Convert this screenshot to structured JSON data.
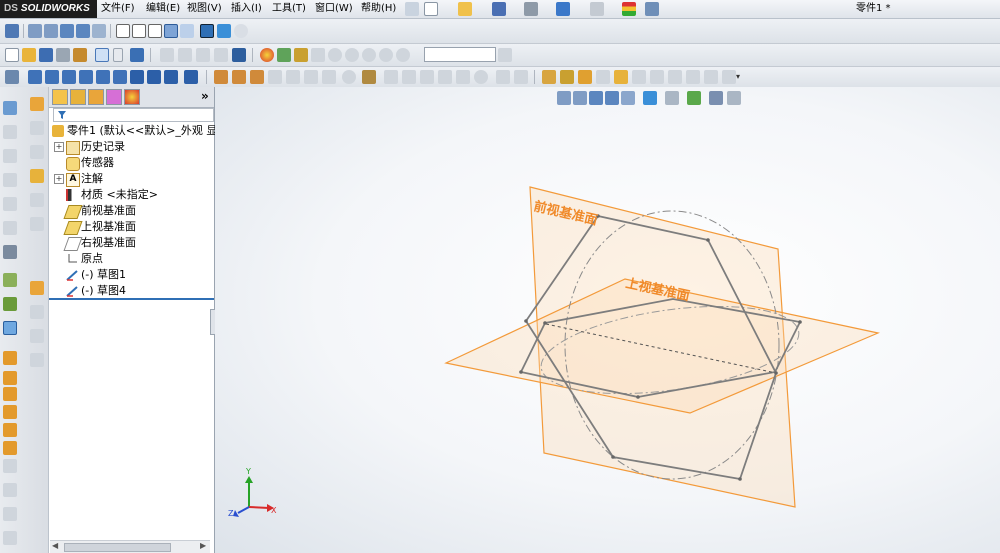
{
  "app": {
    "brand": "SOLIDWORKS",
    "brand_prefix": "DS",
    "doc_title": "零件1 *"
  },
  "menu": [
    "文件(F)",
    "编辑(E)",
    "视图(V)",
    "插入(I)",
    "工具(T)",
    "窗口(W)",
    "帮助(H)"
  ],
  "tree": {
    "root": "零件1 (默认<<默认>_外观 显",
    "items": [
      "历史记录",
      "传感器",
      "注解",
      "材质 <未指定>",
      "前视基准面",
      "上视基准面",
      "右视基准面",
      "原点",
      "(-) 草图1",
      "(-) 草图4"
    ]
  },
  "viewport": {
    "front_plane_label": "前视基准面",
    "top_plane_label": "上视基准面",
    "triad": {
      "y": "Y",
      "x": "X",
      "z": "Z"
    }
  },
  "colors": {
    "plane_border": "#f39a3a",
    "plane_fill": "#fbd9b3",
    "sketch_line": "#7d7d7d",
    "accent": "#2f6fb5"
  },
  "icons": [
    "sketch-icon",
    "smart-dimension-icon",
    "new-icon",
    "open-icon",
    "save-icon",
    "print-icon",
    "undo-icon",
    "redo-icon",
    "select-icon",
    "rebuild-icon",
    "zoom-icon",
    "rotate-icon",
    "view-orientation-icon",
    "display-style-icon",
    "filter-icon"
  ]
}
